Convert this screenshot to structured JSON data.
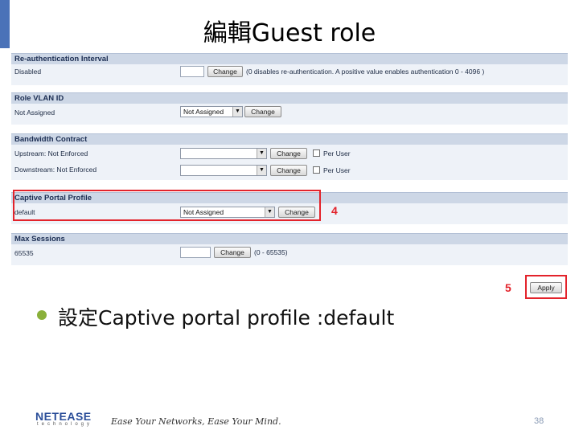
{
  "slide": {
    "title": "編輯Guest role",
    "bullet_text": "設定Captive portal profile :default",
    "page_number": "38",
    "brand": "NETEASE",
    "brand_sub": "technology",
    "slogan": "Ease Your Networks, Ease Your Mind."
  },
  "form": {
    "reauth": {
      "header": "Re-authentication Interval",
      "label": "Disabled",
      "value": "",
      "button": "Change",
      "hint": "(0 disables re-authentication. A positive value enables authentication 0 - 4096 )"
    },
    "vlan": {
      "header": "Role VLAN ID",
      "label": "Not Assigned",
      "select_value": "Not Assigned",
      "button": "Change"
    },
    "bandwidth": {
      "header": "Bandwidth Contract",
      "upstream_label": "Upstream:  Not Enforced",
      "upstream_value": "",
      "upstream_button": "Change",
      "upstream_check": "Per User",
      "downstream_label": "Downstream: Not Enforced",
      "downstream_value": "",
      "downstream_button": "Change",
      "downstream_check": "Per User"
    },
    "captive": {
      "header": "Captive Portal Profile",
      "label": "default",
      "select_value": "Not Assigned",
      "button": "Change"
    },
    "max_sessions": {
      "header": "Max Sessions",
      "label": "65535",
      "value": "",
      "button": "Change",
      "hint": "(0 - 65535)"
    },
    "apply_button": "Apply"
  },
  "annotations": {
    "marker_4": "4",
    "marker_5": "5"
  }
}
